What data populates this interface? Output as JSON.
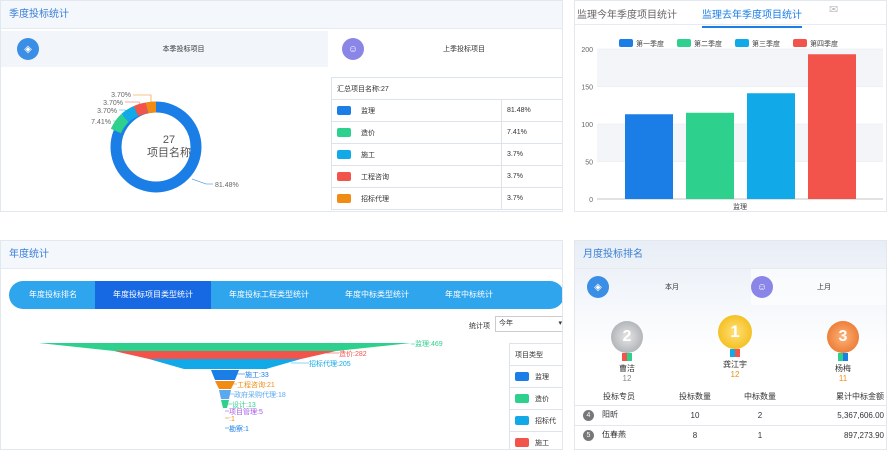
{
  "p1": {
    "title": "季度投标统计",
    "tab_current": "本季投标项目",
    "tab_last": "上季投标项目",
    "center_value": "27",
    "center_label": "项目名称",
    "summary_header": "汇总项目名称:27",
    "rows": [
      {
        "name": "监理",
        "pct": "81.48%",
        "color": "#1b7ee6"
      },
      {
        "name": "造价",
        "pct": "7.41%",
        "color": "#2dd08d"
      },
      {
        "name": "施工",
        "pct": "3.7%",
        "color": "#11a9e8"
      },
      {
        "name": "工程咨询",
        "pct": "3.7%",
        "color": "#f2544c"
      },
      {
        "name": "招标代理",
        "pct": "3.7%",
        "color": "#f08c14"
      }
    ],
    "donut_labels": [
      "3.70%",
      "3.70%",
      "3.70%",
      "7.41%",
      "81.48%"
    ]
  },
  "p2": {
    "tab_this": "监理今年季度项目统计",
    "tab_last": "监理去年季度项目统计",
    "legend": [
      "第一季度",
      "第二季度",
      "第三季度",
      "第四季度"
    ],
    "xlabel": "监理",
    "yticks": [
      "200",
      "150",
      "100",
      "50",
      "0"
    ]
  },
  "chart_data": {
    "type": "bar",
    "categories": [
      "监理"
    ],
    "series": [
      {
        "name": "第一季度",
        "values": [
          113
        ]
      },
      {
        "name": "第二季度",
        "values": [
          115
        ]
      },
      {
        "name": "第三季度",
        "values": [
          141
        ]
      },
      {
        "name": "第四季度",
        "values": [
          193
        ]
      }
    ],
    "ylim": [
      0,
      200
    ],
    "colors": [
      "#1b7ee6",
      "#2dd08d",
      "#11a9e8",
      "#f2544c"
    ],
    "xlabel": "监理"
  },
  "p3": {
    "title": "年度统计",
    "nav": [
      "年度投标排名",
      "年度投标项目类型统计",
      "年度投标工程类型统计",
      "年度中标类型统计",
      "年度中标统计"
    ],
    "filter_label": "统计项",
    "filter_value": "今年",
    "legend_header": "项目类型",
    "legend": [
      {
        "name": "监理",
        "color": "#1b7ee6"
      },
      {
        "name": "造价",
        "color": "#2dd08d"
      },
      {
        "name": "招标代",
        "color": "#11a9e8"
      },
      {
        "name": "施工",
        "color": "#f2544c"
      }
    ],
    "funnel": [
      {
        "label": "监理:469",
        "color": "#2dd08d"
      },
      {
        "label": "造价:282",
        "color": "#f2544c"
      },
      {
        "label": "招标代理:205",
        "color": "#11a9e8"
      },
      {
        "label": "施工:33",
        "color": "#1b7ee6"
      },
      {
        "label": "工程咨询:21",
        "color": "#f08c14"
      },
      {
        "label": "政府采购代理:18",
        "color": "#5aa9f0"
      },
      {
        "label": "设计:13",
        "color": "#2dd08d"
      },
      {
        "label": "项目管理:5",
        "color": "#a259e6"
      },
      {
        "label": ":1",
        "color": "#f08c14"
      },
      {
        "label": "勘察:1",
        "color": "#1b7ee6"
      }
    ]
  },
  "p4": {
    "title": "月度投标排名",
    "tab_this": "本月",
    "tab_last": "上月",
    "top3": [
      {
        "rank": "2",
        "name": "曹洁",
        "score": "12"
      },
      {
        "rank": "1",
        "name": "龚江宇",
        "score": "12"
      },
      {
        "rank": "3",
        "name": "杨梅",
        "score": "11"
      }
    ],
    "headers": [
      "投标专员",
      "投标数量",
      "中标数量",
      "累计中标金额"
    ],
    "rows": [
      {
        "rank": "4",
        "name": "阳昕",
        "bids": "10",
        "wins": "2",
        "amount": "5,367,606.00"
      },
      {
        "rank": "5",
        "name": "伍春燕",
        "bids": "8",
        "wins": "1",
        "amount": "897,273.90"
      }
    ]
  }
}
